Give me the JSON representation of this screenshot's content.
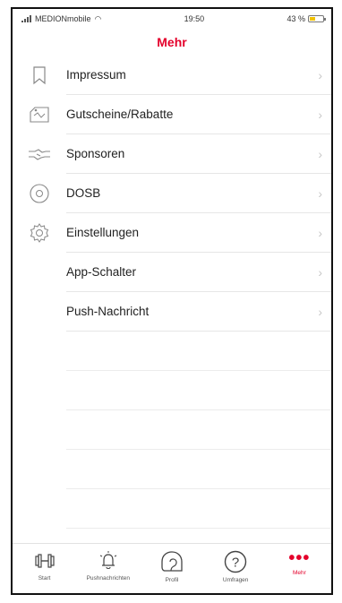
{
  "status": {
    "carrier": "MEDIONmobile",
    "time": "19:50",
    "battery": "43 %",
    "battery_level": 0.43
  },
  "header": {
    "title": "Mehr"
  },
  "menu": [
    {
      "label": "Impressum",
      "icon": "bookmark-icon"
    },
    {
      "label": "Gutscheine/Rabatte",
      "icon": "voucher-icon"
    },
    {
      "label": "Sponsoren",
      "icon": "handshake-icon"
    },
    {
      "label": "DOSB",
      "icon": "dosb-logo-icon"
    },
    {
      "label": "Einstellungen",
      "icon": "gear-icon"
    },
    {
      "label": "App-Schalter",
      "icon": ""
    },
    {
      "label": "Push-Nachricht",
      "icon": ""
    }
  ],
  "tabs": [
    {
      "label": "Start",
      "icon": "dumbbell-icon"
    },
    {
      "label": "Pushnachrichten",
      "icon": "bell-icon"
    },
    {
      "label": "Profil",
      "icon": "profile-icon"
    },
    {
      "label": "Umfragen",
      "icon": "question-icon"
    },
    {
      "label": "Mehr",
      "icon": "more-icon"
    }
  ],
  "colors": {
    "accent": "#e4002b",
    "chevron": "#c8c8c8",
    "battery": "#f2c200"
  }
}
